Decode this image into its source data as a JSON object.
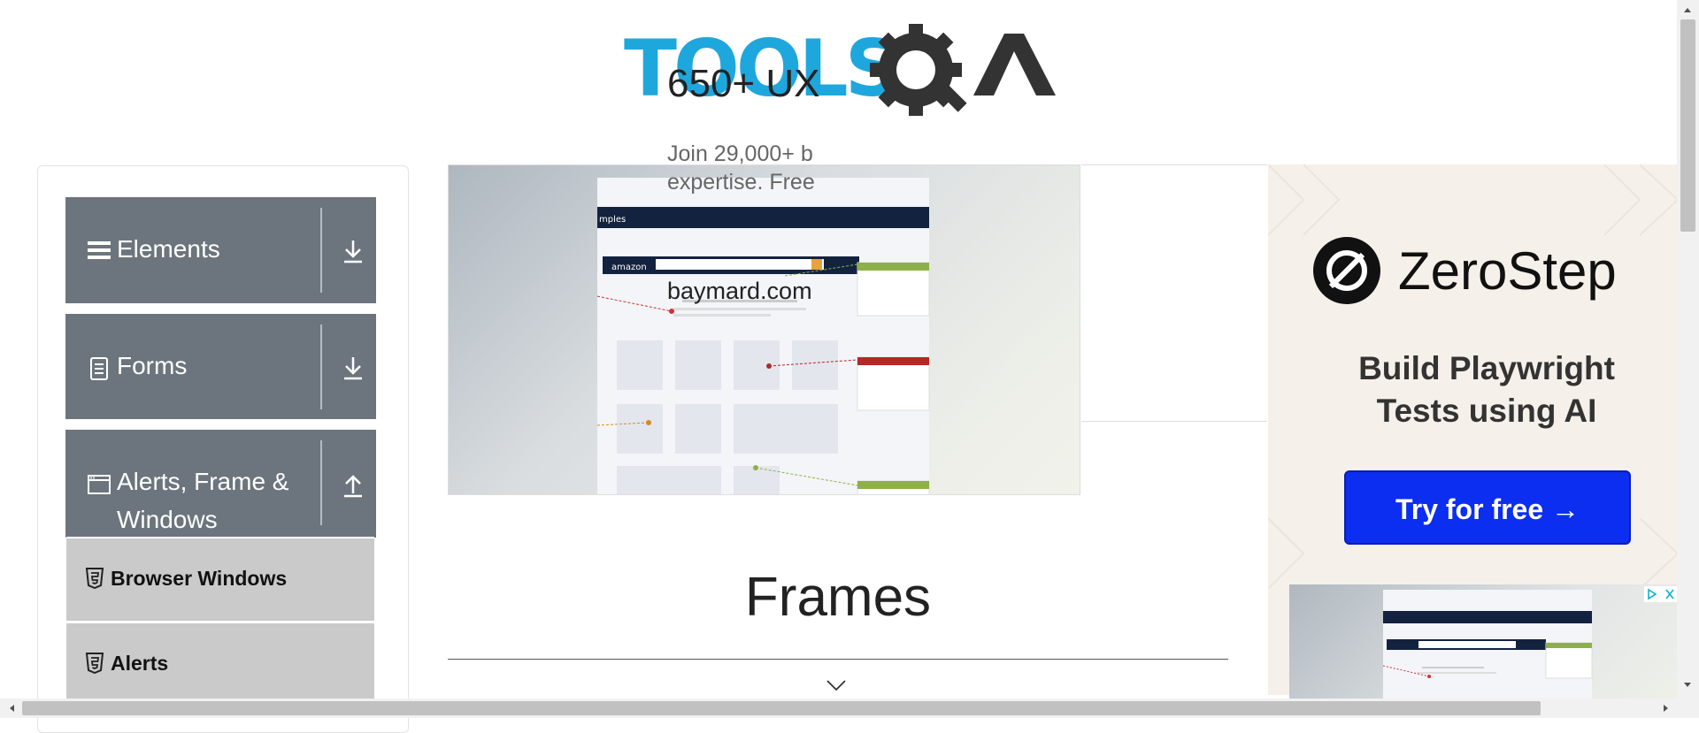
{
  "logo": {
    "text": "TOOLSQA",
    "brand_color": "#1ea7dd",
    "gear_color": "#333333"
  },
  "sidebar": {
    "groups": [
      {
        "label": "Elements",
        "icon": "hamburger-icon",
        "expand_icon": "download-arrow-icon"
      },
      {
        "label": "Forms",
        "icon": "document-icon",
        "expand_icon": "download-arrow-icon"
      },
      {
        "label_line1": "Alerts, Frame &",
        "label_line2": "Windows",
        "icon": "window-icon",
        "expand_icon": "upload-arrow-icon"
      }
    ],
    "subitems": [
      {
        "label": "Browser Windows",
        "icon": "html5-icon"
      },
      {
        "label": "Alerts",
        "icon": "html5-icon"
      }
    ],
    "group_color": "#6c757d",
    "subitem_color": "#cacaca"
  },
  "ad_banner": {
    "title": "650+ UX",
    "description_line1": "Join 29,000+ b",
    "description_line2": "expertise. Free",
    "domain": "baymard.com",
    "image_brand": "amazon"
  },
  "right_ad": {
    "brand": "ZeroStep",
    "tagline_line1": "Build Playwright",
    "tagline_line2": "Tests using AI",
    "cta": "Try for free →",
    "cta_color": "#0b2ef0"
  },
  "main": {
    "heading": "Frames"
  }
}
